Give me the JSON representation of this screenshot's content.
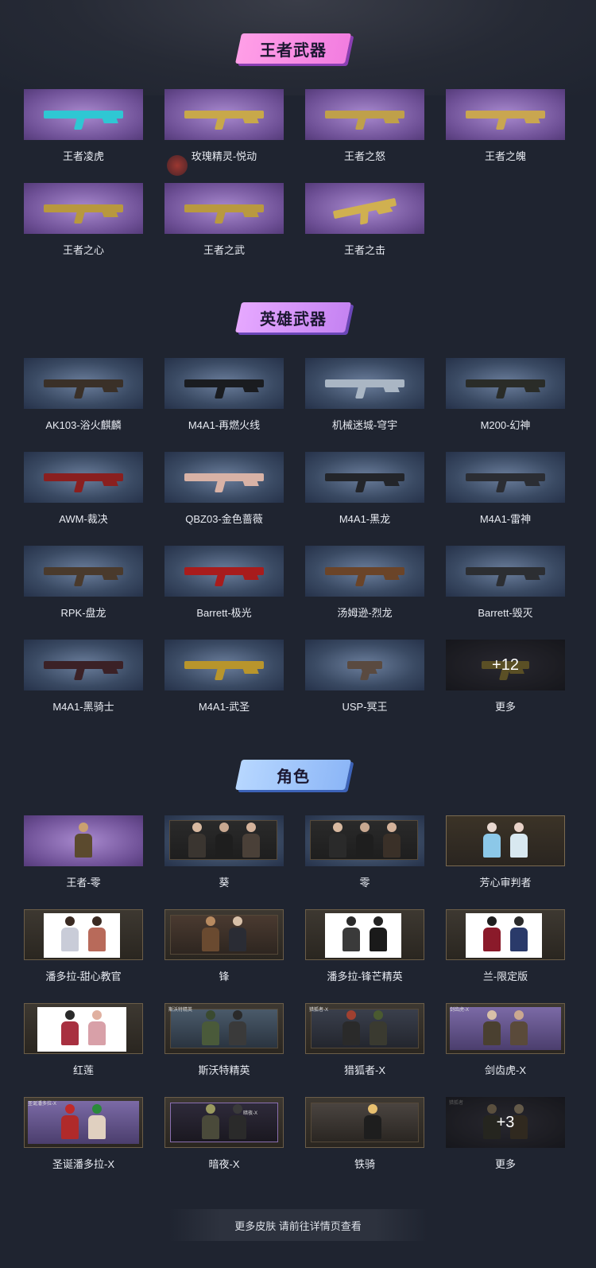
{
  "sections": {
    "king": {
      "title": "王者武器",
      "items": [
        "王者凌虎",
        "玫瑰精灵-悦动",
        "王者之怒",
        "王者之魄",
        "王者之心",
        "王者之武",
        "王者之击"
      ]
    },
    "hero": {
      "title": "英雄武器",
      "items": [
        "AK103-浴火麒麟",
        "M4A1-再燃火线",
        "机械迷城-穹宇",
        "M200-幻神",
        "AWM-裁决",
        "QBZ03-金色蔷薇",
        "M4A1-黑龙",
        "M4A1-雷神",
        "RPK-盘龙",
        "Barrett-极光",
        "汤姆逊-烈龙",
        "Barrett-毁灭",
        "M4A1-黑骑士",
        "M4A1-武圣",
        "USP-冥王",
        "更多"
      ],
      "more_badge": "+12"
    },
    "roles": {
      "title": "角色",
      "items": [
        "王者-零",
        "葵",
        "零",
        "芳心审判者",
        "潘多拉-甜心教官",
        "锋",
        "潘多拉-锋芒精英",
        "兰-限定版",
        "红莲",
        "斯沃特精英",
        "猎狐者-X",
        "剑齿虎-X",
        "圣诞潘多拉-X",
        "暗夜-X",
        "铁骑",
        "更多"
      ],
      "more_badge": "+3",
      "tags": {
        "swat": "斯沃特精英",
        "hunter": "猎狐者-X",
        "tiger": "剑齿虎-X",
        "xmas": "圣诞潘多拉-X",
        "night": "暗夜-X",
        "more": "猎狐者"
      }
    }
  },
  "footer": {
    "label": "更多皮肤 请前往详情页查看"
  }
}
